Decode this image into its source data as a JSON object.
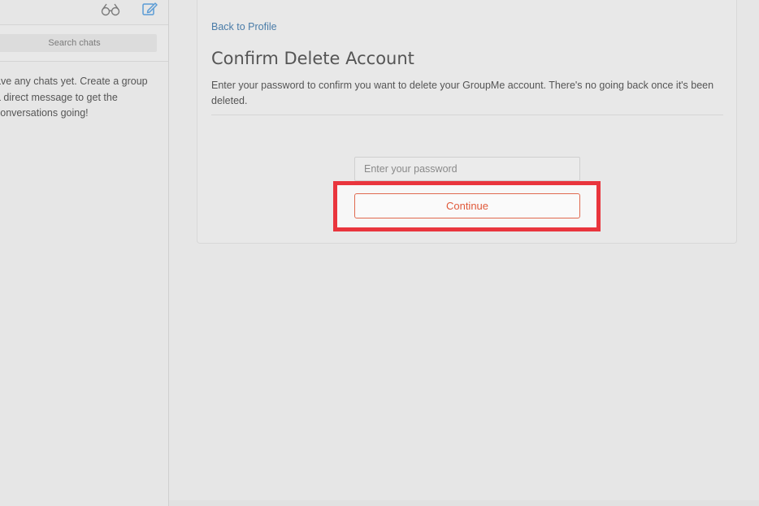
{
  "sidebar": {
    "search_placeholder": "Search chats",
    "empty_message": {
      "line1": "ave any chats yet. Create a group",
      "line2": " a direct message to get the",
      "line3": "conversations going!"
    }
  },
  "main": {
    "back_link": "Back to Profile",
    "title": "Confirm Delete Account",
    "description": "Enter your password to confirm you want to delete your GroupMe account. There's no going back once it's been deleted.",
    "password_placeholder": "Enter your password",
    "continue_label": "Continue"
  },
  "colors": {
    "accent_link": "#4a7ca8",
    "danger": "#e0593a",
    "highlight": "#e9353d"
  },
  "icons": {
    "top_left": "glasses-icon",
    "top_right": "compose-icon"
  }
}
